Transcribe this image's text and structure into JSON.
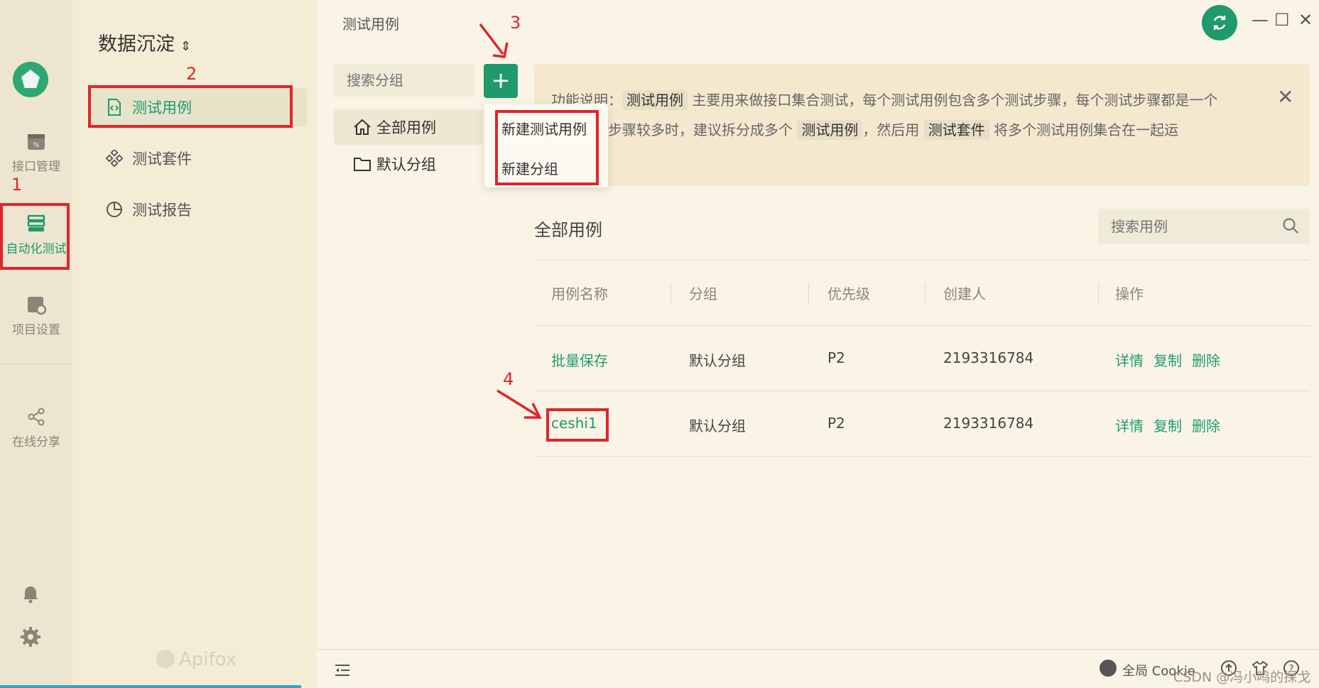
{
  "rail": {
    "items": [
      {
        "label": "接口管理",
        "icon": "api-management-icon"
      },
      {
        "label": "自动化测试",
        "icon": "automation-test-icon",
        "active": true
      },
      {
        "label": "项目设置",
        "icon": "project-settings-icon"
      },
      {
        "label": "在线分享",
        "icon": "share-icon"
      }
    ],
    "bottom_icons": [
      "bell-icon",
      "gear-icon"
    ]
  },
  "nav2": {
    "project_name": "数据沉淀",
    "project_chevron": "⌃⌄",
    "items": [
      {
        "label": "测试用例",
        "icon": "test-case-icon",
        "active": true
      },
      {
        "label": "测试套件",
        "icon": "test-suite-icon"
      },
      {
        "label": "测试报告",
        "icon": "test-report-icon"
      }
    ],
    "brand": "Apifox"
  },
  "main": {
    "title": "测试用例",
    "window_controls": {
      "minimize": "—",
      "maximize": "☐",
      "close": "✕"
    },
    "group_search": {
      "placeholder": "搜索分组"
    },
    "add_label": "+",
    "tree": [
      {
        "label": "全部用例",
        "icon": "home-icon",
        "active": true
      },
      {
        "label": "默认分组",
        "icon": "folder-icon"
      }
    ],
    "dropdown": [
      "新建测试用例",
      "新建分组"
    ],
    "info": {
      "prefix": "功能说明：",
      "tag1": "测试用例",
      "text1": "主要用来做接口集合测试，每个测试用例包含多个测试步骤，每个测试步骤都是一个",
      "text2": "口。测试步骤较多时，建议拆分成多个",
      "tag2": "测试用例",
      "text3": "，然后用",
      "tag3": "测试套件",
      "text4": "将多个测试用例集合在一起运",
      "close": "✕"
    },
    "section_title": "全部用例",
    "case_search": {
      "placeholder": "搜索用例"
    },
    "table": {
      "headers": [
        "用例名称",
        "分组",
        "优先级",
        "创建人",
        "操作"
      ],
      "rows": [
        {
          "name": "批量保存",
          "group": "默认分组",
          "priority": "P2",
          "creator": "2193316784"
        },
        {
          "name": "ceshi1",
          "group": "默认分组",
          "priority": "P2",
          "creator": "2193316784"
        }
      ],
      "actions": [
        "详情",
        "复制",
        "删除"
      ]
    },
    "footer": {
      "cookie": "全局 Cookie",
      "watermark": "CSDN @冯小鸣的探戈"
    }
  },
  "annotations": {
    "color": "#e0252b",
    "labels": [
      "1",
      "2",
      "3",
      "4"
    ]
  },
  "colors": {
    "accent": "#1f9a6b",
    "rail_bg": "#ede5cf",
    "nav_bg": "#f5ecd6",
    "main_bg": "#faf4e6",
    "info_bg": "#f4e9cf",
    "annotation": "#e0252b"
  }
}
